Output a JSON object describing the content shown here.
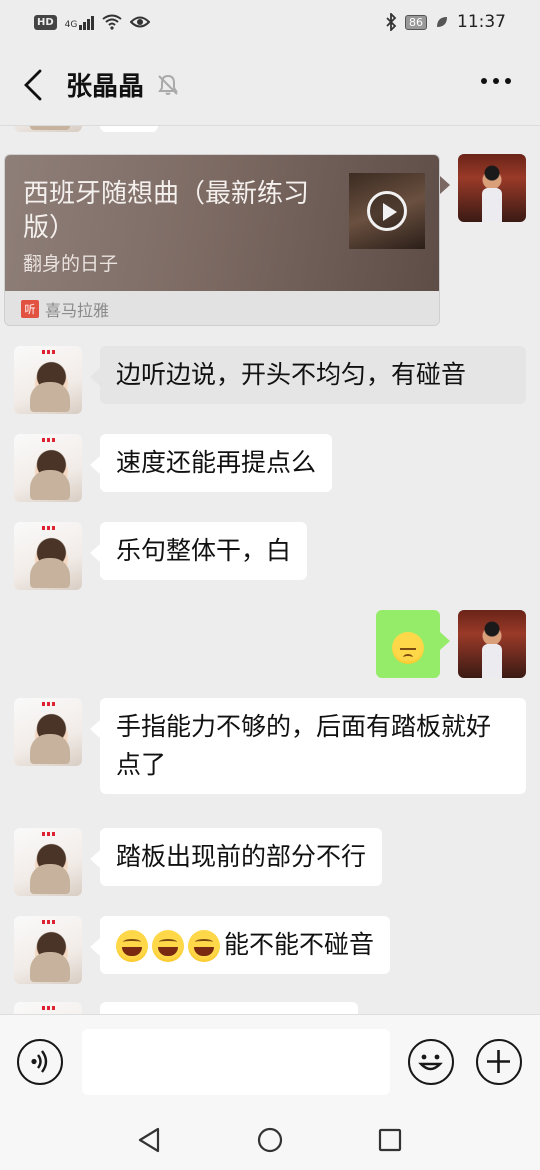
{
  "status_bar": {
    "left_badges": [
      "HD",
      "4G"
    ],
    "battery": "86",
    "time": "11:37"
  },
  "header": {
    "title": "张晶晶"
  },
  "music_card": {
    "title": "西班牙随想曲（最新练习版）",
    "subtitle": "翻身的日子",
    "source": "喜马拉雅",
    "source_icon_text": "听"
  },
  "messages": [
    {
      "side": "left",
      "text": "边听边说，开头不均匀，有碰音"
    },
    {
      "side": "left",
      "text": "速度还能再提点么"
    },
    {
      "side": "left",
      "text": "乐句整体干，白"
    },
    {
      "side": "right",
      "emoji": "pensive-face"
    },
    {
      "side": "left",
      "text": "手指能力不够的，后面有踏板就好点了"
    },
    {
      "side": "left",
      "text": "踏板出现前的部分不行"
    },
    {
      "side": "left",
      "emoji_prefix": [
        "grinning-squinting-face",
        "grinning-squinting-face",
        "grinning-squinting-face"
      ],
      "text": "能不能不碰音"
    }
  ],
  "input": {
    "value": "",
    "placeholder": ""
  },
  "colors": {
    "background": "#ededed",
    "bubble_self": "#95ec69",
    "bubble_other": "#ffffff",
    "bubble_highlight": "#e5e5e5"
  }
}
